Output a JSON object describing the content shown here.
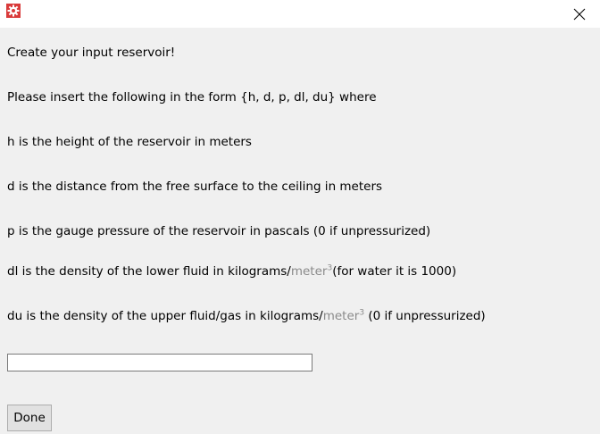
{
  "window": {
    "close_glyph": "✕",
    "app_icon": "gear-icon",
    "accent_color": "#d9534f"
  },
  "lines": {
    "l1": "Create your input reservoir!",
    "l2": "Please insert the following in the form {h, d, p, dl, du} where",
    "l3": "h is the height of the reservoir in meters",
    "l4": "d is the distance from the free surface to the ceiling in meters",
    "l5": "p is the gauge pressure of the reservoir in pascals (0 if unpressurized)",
    "l6_pre": "dl is the density of the lower fluid in kilograms/",
    "l6_unit": "meter",
    "l6_exp": "3",
    "l6_post": "(for water it is 1000)",
    "l7_pre": "du is the density of the upper fluid/gas in kilograms/",
    "l7_unit": "meter",
    "l7_exp": "3",
    "l7_post": " (0 if unpressurized)"
  },
  "input": {
    "value": "",
    "placeholder": ""
  },
  "buttons": {
    "done_label": "Done"
  }
}
